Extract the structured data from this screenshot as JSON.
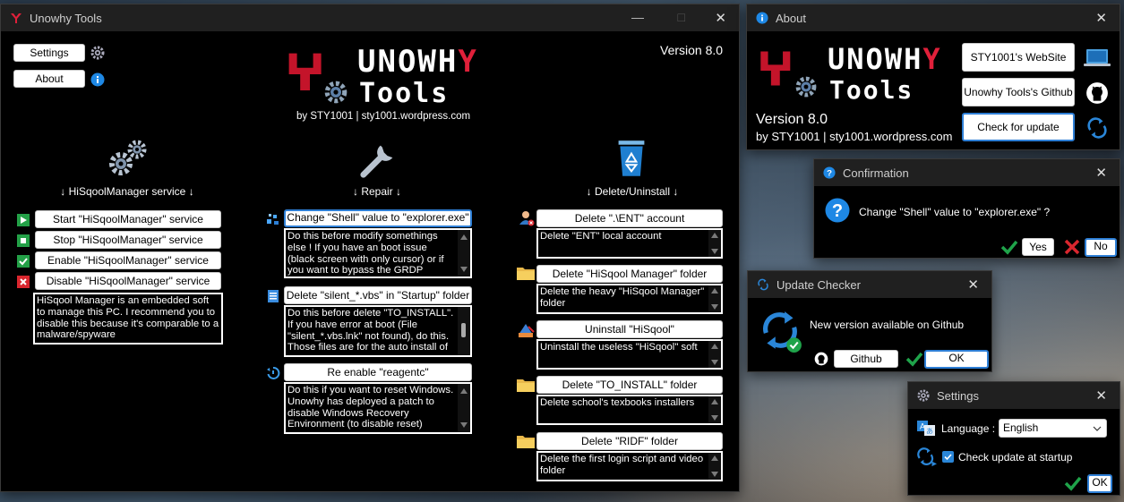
{
  "main": {
    "title": "Unowhy Tools",
    "version": "Version 8.0",
    "settings_label": "Settings",
    "about_label": "About",
    "logo_line1a": "UNOWH",
    "logo_line1b": "Y",
    "logo_line2": "Tools",
    "byline": "by STY1001 | sty1001.wordpress.com",
    "col1": {
      "heading": "↓ HiSqoolManager service ↓",
      "start": "Start \"HiSqoolManager\" service",
      "stop": "Stop \"HiSqoolManager\" service",
      "enable": "Enable \"HiSqoolManager\" service",
      "disable": "Disable \"HiSqoolManager\" service",
      "desc": "HiSqool Manager is an embedded soft to manage this PC. I recommend you to disable this because it's comparable to a malware/spyware"
    },
    "col2": {
      "heading": "↓ Repair ↓",
      "shell_btn": "Change \"Shell\" value to \"explorer.exe\"",
      "shell_desc": "Do this before modify somethings else ! If you have an boot issue (black screen with only cursor) or if you want to bypass the GRDP agreement, do this",
      "silent_btn": "Delete \"silent_*.vbs\" in \"Startup\" folder",
      "silent_desc": "Do this before delete \"TO_INSTALL\". If you have error at boot (File \"silent_*.vbs.lnk\" not found), do this. Those files are for the auto install of",
      "reagent_btn": "Re enable \"reagentc\"",
      "reagent_desc": "Do this if you want to reset Windows. Unowhy has deployed a patch to disable Windows Recovery Environment (to disable reset)"
    },
    "col3": {
      "heading": "↓ Delete/Uninstall ↓",
      "ent_btn": "Delete \".\\ENT\" account",
      "ent_desc": "Delete \"ENT\" local account",
      "hsm_btn": "Delete \"HiSqool Manager\" folder",
      "hsm_desc": "Delete the heavy \"HiSqool Manager\" folder",
      "hisqool_btn": "Uninstall \"HiSqool\"",
      "hisqool_desc": "Uninstall the useless \"HiSqool\" soft",
      "toinstall_btn": "Delete \"TO_INSTALL\" folder",
      "toinstall_desc": "Delete school's texbooks installers",
      "ridf_btn": "Delete \"RIDF\" folder",
      "ridf_desc": "Delete the first login script and video folder"
    }
  },
  "about": {
    "title": "About",
    "website_btn": "STY1001's WebSite",
    "github_btn": "Unowhy Tools's Github",
    "update_btn": "Check for update",
    "version": "Version 8.0",
    "byline": "by STY1001 | sty1001.wordpress.com"
  },
  "confirm": {
    "title": "Confirmation",
    "message": "Change \"Shell\" value to \"explorer.exe\" ?",
    "yes": "Yes",
    "no": "No"
  },
  "updater": {
    "title": "Update Checker",
    "message": "New version available on Github",
    "github_btn": "Github",
    "ok_btn": "OK"
  },
  "settings": {
    "title": "Settings",
    "language_label": "Language :",
    "language_value": "English",
    "check_update_label": "Check update at startup",
    "check_update_checked": true,
    "ok_btn": "OK"
  },
  "colors": {
    "accent_red": "#e0203a",
    "accent_blue": "#2a86d8",
    "ok_green": "#1fa34a"
  }
}
